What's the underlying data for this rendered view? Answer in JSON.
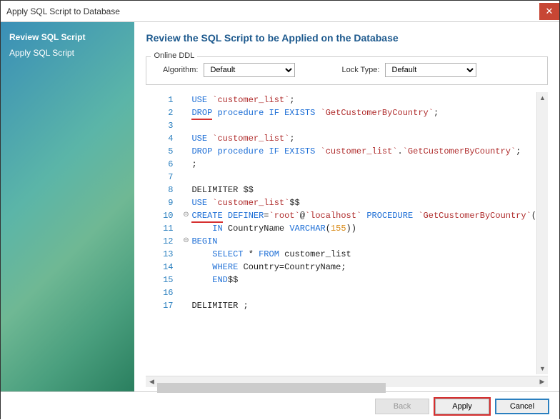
{
  "window": {
    "title": "Apply SQL Script to Database"
  },
  "sidebar": {
    "items": [
      {
        "label": "Review SQL Script",
        "active": true
      },
      {
        "label": "Apply SQL Script",
        "active": false
      }
    ]
  },
  "main": {
    "title": "Review the SQL Script to be Applied on the Database",
    "ddl": {
      "legend": "Online DDL",
      "algorithm_label": "Algorithm:",
      "algorithm_value": "Default",
      "locktype_label": "Lock Type:",
      "locktype_value": "Default"
    }
  },
  "code": {
    "lines": [
      {
        "n": 1,
        "tokens": [
          {
            "t": "USE ",
            "c": "kw"
          },
          {
            "t": "`customer_list`",
            "c": "str"
          },
          {
            "t": ";",
            "c": "id"
          }
        ]
      },
      {
        "n": 2,
        "tokens": [
          {
            "t": "DROP",
            "c": "kw",
            "u": true
          },
          {
            "t": " procedure IF EXISTS ",
            "c": "kw"
          },
          {
            "t": "`GetCustomerByCountry`",
            "c": "str"
          },
          {
            "t": ";",
            "c": "id"
          }
        ]
      },
      {
        "n": 3,
        "tokens": []
      },
      {
        "n": 4,
        "tokens": [
          {
            "t": "USE ",
            "c": "kw"
          },
          {
            "t": "`customer_list`",
            "c": "str"
          },
          {
            "t": ";",
            "c": "id"
          }
        ]
      },
      {
        "n": 5,
        "tokens": [
          {
            "t": "DROP procedure IF EXISTS ",
            "c": "kw"
          },
          {
            "t": "`customer_list`",
            "c": "str"
          },
          {
            "t": ".",
            "c": "id"
          },
          {
            "t": "`GetCustomerByCountry`",
            "c": "str"
          },
          {
            "t": ";",
            "c": "id"
          }
        ]
      },
      {
        "n": 6,
        "tokens": [
          {
            "t": ";",
            "c": "id"
          }
        ]
      },
      {
        "n": 7,
        "tokens": []
      },
      {
        "n": 8,
        "tokens": [
          {
            "t": "DELIMITER $$",
            "c": "id"
          }
        ]
      },
      {
        "n": 9,
        "tokens": [
          {
            "t": "USE ",
            "c": "kw"
          },
          {
            "t": "`customer_list`",
            "c": "str"
          },
          {
            "t": "$$",
            "c": "id"
          }
        ]
      },
      {
        "n": 10,
        "fold": true,
        "tokens": [
          {
            "t": "CREATE",
            "c": "kw",
            "u": true
          },
          {
            "t": " DEFINER",
            "c": "kw"
          },
          {
            "t": "=",
            "c": "id"
          },
          {
            "t": "`root`",
            "c": "str"
          },
          {
            "t": "@",
            "c": "id"
          },
          {
            "t": "`localhost`",
            "c": "str"
          },
          {
            "t": " PROCEDURE ",
            "c": "kw"
          },
          {
            "t": "`GetCustomerByCountry`",
            "c": "str"
          },
          {
            "t": "(",
            "c": "id"
          }
        ]
      },
      {
        "n": 11,
        "indent": 1,
        "tokens": [
          {
            "t": "IN ",
            "c": "kw"
          },
          {
            "t": "CountryName ",
            "c": "id"
          },
          {
            "t": "VARCHAR",
            "c": "kw"
          },
          {
            "t": "(",
            "c": "id"
          },
          {
            "t": "155",
            "c": "num"
          },
          {
            "t": "))",
            "c": "id"
          }
        ]
      },
      {
        "n": 12,
        "fold": true,
        "tokens": [
          {
            "t": "BEGIN",
            "c": "kw"
          }
        ]
      },
      {
        "n": 13,
        "indent": 1,
        "tokens": [
          {
            "t": "SELECT ",
            "c": "kw"
          },
          {
            "t": "* ",
            "c": "id"
          },
          {
            "t": "FROM ",
            "c": "kw"
          },
          {
            "t": "customer_list",
            "c": "id"
          }
        ]
      },
      {
        "n": 14,
        "indent": 1,
        "tokens": [
          {
            "t": "WHERE ",
            "c": "kw"
          },
          {
            "t": "Country=CountryName;",
            "c": "id"
          }
        ]
      },
      {
        "n": 15,
        "indent": 1,
        "tokens": [
          {
            "t": "END",
            "c": "kw"
          },
          {
            "t": "$$",
            "c": "id"
          }
        ]
      },
      {
        "n": 16,
        "tokens": []
      },
      {
        "n": 17,
        "tokens": [
          {
            "t": "DELIMITER ;",
            "c": "id"
          }
        ]
      }
    ]
  },
  "footer": {
    "back": "Back",
    "apply": "Apply",
    "cancel": "Cancel"
  }
}
